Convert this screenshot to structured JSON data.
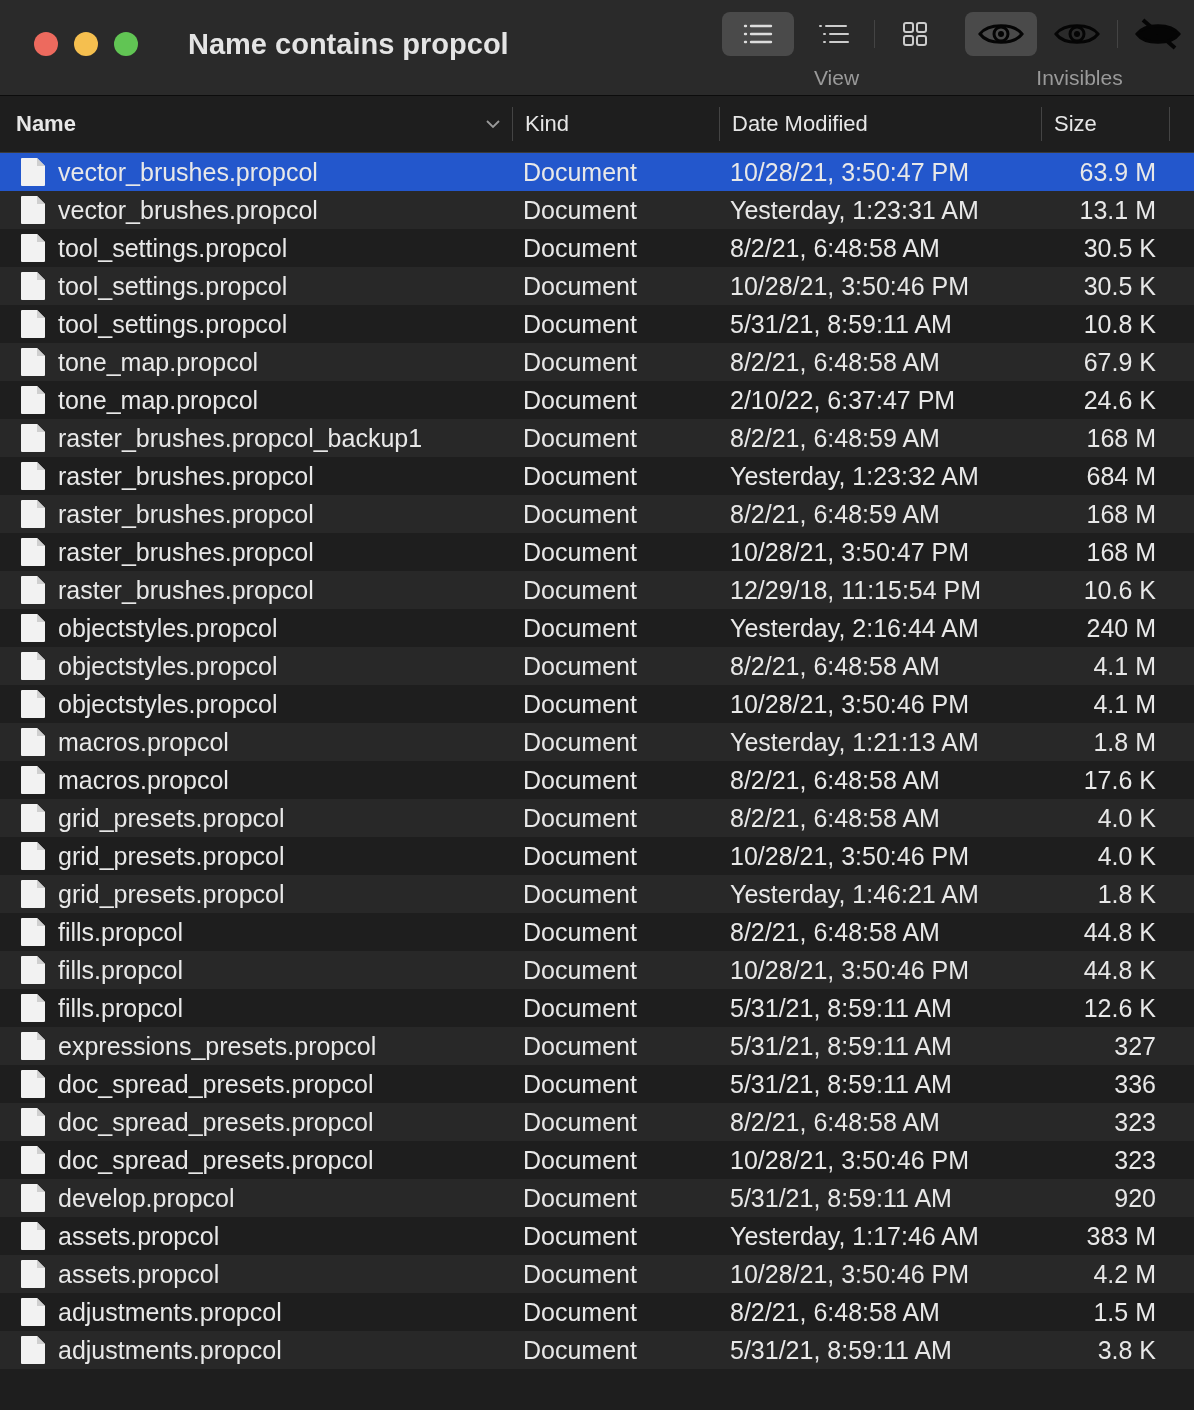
{
  "window": {
    "title": "Name contains propcol"
  },
  "toolbar": {
    "view": {
      "label": "View",
      "buttons": [
        {
          "kind": "list",
          "selected": true
        },
        {
          "kind": "outline",
          "selected": false
        },
        {
          "kind": "grid",
          "selected": false
        }
      ]
    },
    "invisibles": {
      "label": "Invisibles",
      "buttons": [
        {
          "kind": "eye",
          "selected": true
        },
        {
          "kind": "eye",
          "selected": false
        },
        {
          "kind": "eye-slash",
          "selected": false
        }
      ]
    }
  },
  "table": {
    "columns": [
      {
        "label": "Name",
        "sorted": true
      },
      {
        "label": "Kind",
        "sorted": false
      },
      {
        "label": "Date Modified",
        "sorted": false
      },
      {
        "label": "Size",
        "sorted": false
      }
    ],
    "rows": [
      {
        "name": "vector_brushes.propcol",
        "kind": "Document",
        "date": "10/28/21, 3:50:47 PM",
        "size": "63.9 M",
        "selected": true
      },
      {
        "name": "vector_brushes.propcol",
        "kind": "Document",
        "date": "Yesterday, 1:23:31 AM",
        "size": "13.1 M",
        "selected": false
      },
      {
        "name": "tool_settings.propcol",
        "kind": "Document",
        "date": "8/2/21, 6:48:58 AM",
        "size": "30.5 K",
        "selected": false
      },
      {
        "name": "tool_settings.propcol",
        "kind": "Document",
        "date": "10/28/21, 3:50:46 PM",
        "size": "30.5 K",
        "selected": false
      },
      {
        "name": "tool_settings.propcol",
        "kind": "Document",
        "date": "5/31/21, 8:59:11 AM",
        "size": "10.8 K",
        "selected": false
      },
      {
        "name": "tone_map.propcol",
        "kind": "Document",
        "date": "8/2/21, 6:48:58 AM",
        "size": "67.9 K",
        "selected": false
      },
      {
        "name": "tone_map.propcol",
        "kind": "Document",
        "date": "2/10/22, 6:37:47 PM",
        "size": "24.6 K",
        "selected": false
      },
      {
        "name": "raster_brushes.propcol_backup1",
        "kind": "Document",
        "date": "8/2/21, 6:48:59 AM",
        "size": "168 M",
        "selected": false
      },
      {
        "name": "raster_brushes.propcol",
        "kind": "Document",
        "date": "Yesterday, 1:23:32 AM",
        "size": "684 M",
        "selected": false
      },
      {
        "name": "raster_brushes.propcol",
        "kind": "Document",
        "date": "8/2/21, 6:48:59 AM",
        "size": "168 M",
        "selected": false
      },
      {
        "name": "raster_brushes.propcol",
        "kind": "Document",
        "date": "10/28/21, 3:50:47 PM",
        "size": "168 M",
        "selected": false
      },
      {
        "name": "raster_brushes.propcol",
        "kind": "Document",
        "date": "12/29/18, 11:15:54 PM",
        "size": "10.6 K",
        "selected": false
      },
      {
        "name": "objectstyles.propcol",
        "kind": "Document",
        "date": "Yesterday, 2:16:44 AM",
        "size": "240 M",
        "selected": false
      },
      {
        "name": "objectstyles.propcol",
        "kind": "Document",
        "date": "8/2/21, 6:48:58 AM",
        "size": "4.1 M",
        "selected": false
      },
      {
        "name": "objectstyles.propcol",
        "kind": "Document",
        "date": "10/28/21, 3:50:46 PM",
        "size": "4.1 M",
        "selected": false
      },
      {
        "name": "macros.propcol",
        "kind": "Document",
        "date": "Yesterday, 1:21:13 AM",
        "size": "1.8 M",
        "selected": false
      },
      {
        "name": "macros.propcol",
        "kind": "Document",
        "date": "8/2/21, 6:48:58 AM",
        "size": "17.6 K",
        "selected": false
      },
      {
        "name": "grid_presets.propcol",
        "kind": "Document",
        "date": "8/2/21, 6:48:58 AM",
        "size": "4.0 K",
        "selected": false
      },
      {
        "name": "grid_presets.propcol",
        "kind": "Document",
        "date": "10/28/21, 3:50:46 PM",
        "size": "4.0 K",
        "selected": false
      },
      {
        "name": "grid_presets.propcol",
        "kind": "Document",
        "date": "Yesterday, 1:46:21 AM",
        "size": "1.8 K",
        "selected": false
      },
      {
        "name": "fills.propcol",
        "kind": "Document",
        "date": "8/2/21, 6:48:58 AM",
        "size": "44.8 K",
        "selected": false
      },
      {
        "name": "fills.propcol",
        "kind": "Document",
        "date": "10/28/21, 3:50:46 PM",
        "size": "44.8 K",
        "selected": false
      },
      {
        "name": "fills.propcol",
        "kind": "Document",
        "date": "5/31/21, 8:59:11 AM",
        "size": "12.6 K",
        "selected": false
      },
      {
        "name": "expressions_presets.propcol",
        "kind": "Document",
        "date": "5/31/21, 8:59:11 AM",
        "size": "327",
        "selected": false
      },
      {
        "name": "doc_spread_presets.propcol",
        "kind": "Document",
        "date": "5/31/21, 8:59:11 AM",
        "size": "336",
        "selected": false
      },
      {
        "name": "doc_spread_presets.propcol",
        "kind": "Document",
        "date": "8/2/21, 6:48:58 AM",
        "size": "323",
        "selected": false
      },
      {
        "name": "doc_spread_presets.propcol",
        "kind": "Document",
        "date": "10/28/21, 3:50:46 PM",
        "size": "323",
        "selected": false
      },
      {
        "name": "develop.propcol",
        "kind": "Document",
        "date": "5/31/21, 8:59:11 AM",
        "size": "920",
        "selected": false
      },
      {
        "name": "assets.propcol",
        "kind": "Document",
        "date": "Yesterday, 1:17:46 AM",
        "size": "383 M",
        "selected": false
      },
      {
        "name": "assets.propcol",
        "kind": "Document",
        "date": "10/28/21, 3:50:46 PM",
        "size": "4.2 M",
        "selected": false
      },
      {
        "name": "adjustments.propcol",
        "kind": "Document",
        "date": "8/2/21, 6:48:58 AM",
        "size": "1.5 M",
        "selected": false
      },
      {
        "name": "adjustments.propcol",
        "kind": "Document",
        "date": "5/31/21, 8:59:11 AM",
        "size": "3.8 K",
        "selected": false
      }
    ]
  }
}
